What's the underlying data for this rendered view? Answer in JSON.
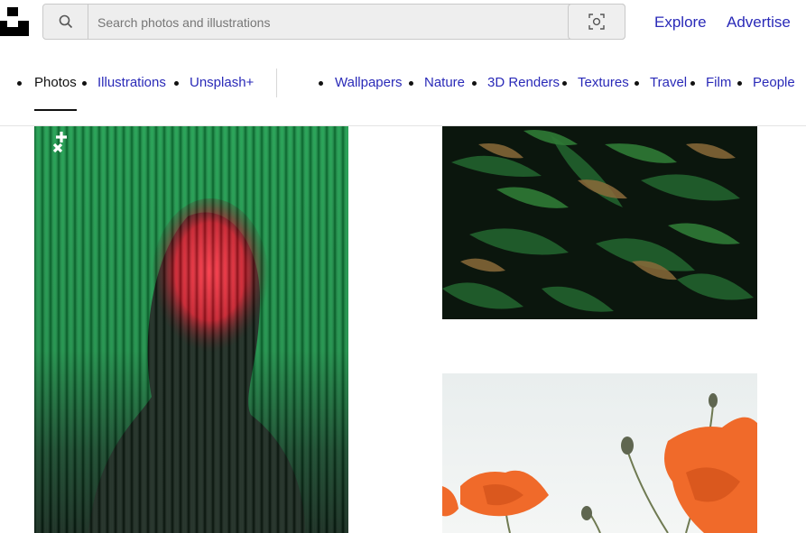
{
  "search": {
    "placeholder": "Search photos and illustrations"
  },
  "header_links": {
    "explore": "Explore",
    "advertise": "Advertise"
  },
  "nav": {
    "primary": [
      "Photos",
      "Illustrations",
      "Unsplash+"
    ],
    "active": "Photos",
    "topics": [
      "Wallpapers",
      "Nature",
      "3D Renders",
      "Textures",
      "Travel",
      "Film",
      "People"
    ]
  },
  "colors": {
    "link": "#2a2ab8",
    "text": "#111111",
    "plus_badge": "#ffffff"
  },
  "photos": [
    {
      "name": "portrait-behind-reeded-glass",
      "plus": true
    },
    {
      "name": "fern-leaves"
    },
    {
      "name": "orange-poppies"
    }
  ]
}
